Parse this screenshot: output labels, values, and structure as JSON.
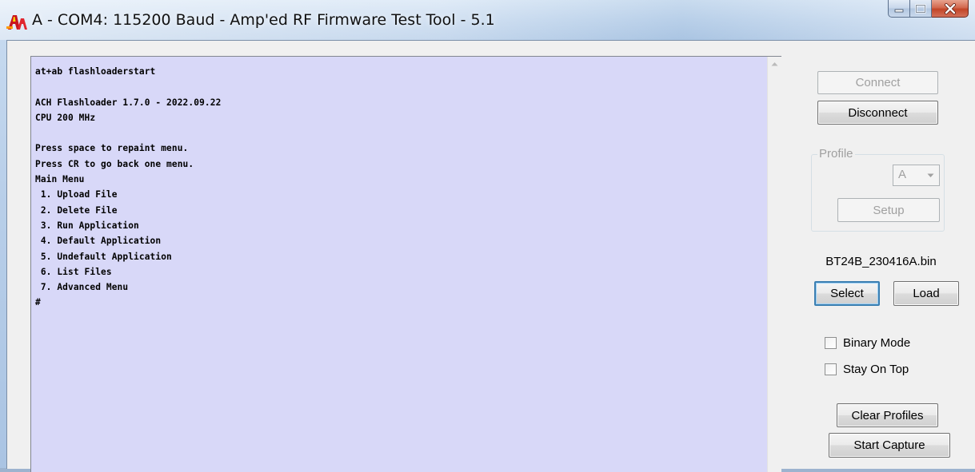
{
  "window": {
    "title": "A - COM4: 115200 Baud - Amp'ed RF Firmware Test Tool - 5.1",
    "icon": "amped-rf-logo-icon"
  },
  "terminal": {
    "lines": [
      "at+ab flashloaderstart",
      "",
      "ACH Flashloader 1.7.0 - 2022.09.22",
      "CPU 200 MHz",
      "",
      "Press space to repaint menu.",
      "Press CR to go back one menu.",
      "Main Menu",
      " 1. Upload File",
      " 2. Delete File",
      " 3. Run Application",
      " 4. Default Application",
      " 5. Undefault Application",
      " 6. List Files",
      " 7. Advanced Menu",
      "#"
    ],
    "background": "#d8d8f8"
  },
  "controls": {
    "connect_label": "Connect",
    "disconnect_label": "Disconnect",
    "profile_group_label": "Profile",
    "profile_value": "A",
    "setup_label": "Setup",
    "filename": "BT24B_230416A.bin",
    "select_label": "Select",
    "load_label": "Load",
    "binary_mode_label": "Binary Mode",
    "binary_mode_checked": false,
    "stay_on_top_label": "Stay On Top",
    "stay_on_top_checked": false,
    "clear_profiles_label": "Clear Profiles",
    "start_capture_label": "Start Capture"
  },
  "colors": {
    "close_button": "#c24527",
    "default_button_border": "#3c7fb1"
  }
}
